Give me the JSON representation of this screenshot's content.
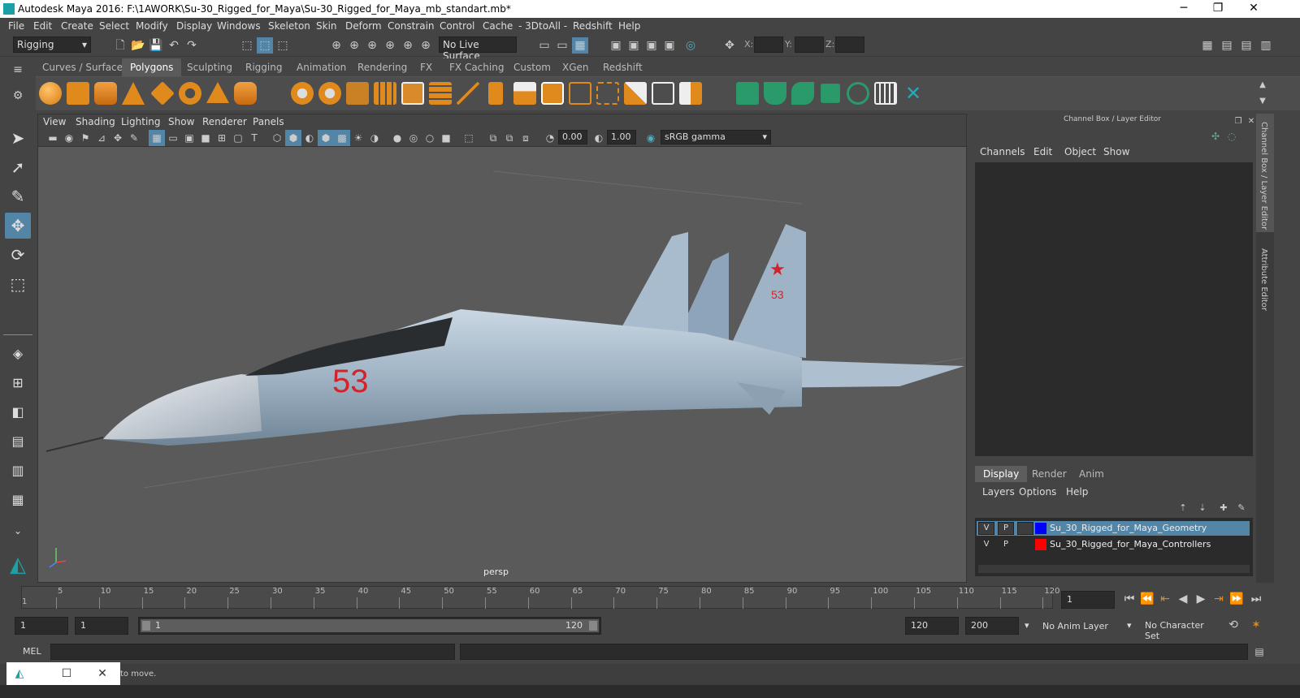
{
  "window": {
    "title": "Autodesk Maya 2016: F:\\1AWORK\\Su-30_Rigged_for_Maya\\Su-30_Rigged_for_Maya_mb_standart.mb*"
  },
  "menubar": [
    "File",
    "Edit",
    "Create",
    "Select",
    "Modify",
    "Display",
    "Windows",
    "Skeleton",
    "Skin",
    "Deform",
    "Constrain",
    "Control",
    "Cache",
    "- 3DtoAll -",
    "Redshift",
    "Help"
  ],
  "status": {
    "mode": "Rigging",
    "live_surface": "No Live Surface",
    "x_label": "X:",
    "y_label": "Y:",
    "z_label": "Z:"
  },
  "shelf_tabs": [
    "Curves / Surfaces",
    "Polygons",
    "Sculpting",
    "Rigging",
    "Animation",
    "Rendering",
    "FX",
    "FX Caching",
    "Custom",
    "XGen",
    "Redshift"
  ],
  "shelf_active": "Polygons",
  "panel": {
    "menu": [
      "View",
      "Shading",
      "Lighting",
      "Show",
      "Renderer",
      "Panels"
    ],
    "exposure": "0.00",
    "gamma": "1.00",
    "colorspace": "sRGB gamma",
    "camera": "persp",
    "nose_number": "53"
  },
  "channel_box": {
    "title": "Channel Box / Layer Editor",
    "menu": [
      "Channels",
      "Edit",
      "Object",
      "Show"
    ],
    "layer_tabs": [
      "Display",
      "Render",
      "Anim"
    ],
    "layer_menu": [
      "Layers",
      "Options",
      "Help"
    ],
    "layers": [
      {
        "v": "V",
        "p": "P",
        "color": "#0000ff",
        "name": "Su_30_Rigged_for_Maya_Geometry",
        "selected": true
      },
      {
        "v": "V",
        "p": "P",
        "color": "#ff0000",
        "name": "Su_30_Rigged_for_Maya_Controllers",
        "selected": false
      }
    ],
    "side_tabs": [
      "Channel Box / Layer Editor",
      "Attribute Editor"
    ]
  },
  "timeline": {
    "ticks": [
      "5",
      "10",
      "15",
      "20",
      "25",
      "30",
      "35",
      "40",
      "45",
      "50",
      "55",
      "60",
      "65",
      "70",
      "75",
      "80",
      "85",
      "90",
      "95",
      "100",
      "105",
      "110",
      "115",
      "120"
    ],
    "start_mark": "1",
    "current_frame": "1"
  },
  "range": {
    "start": "1",
    "playback_start": "1",
    "slider_start": "1",
    "slider_end": "120",
    "playback_end": "120",
    "end": "200",
    "anim_layer": "No Anim Layer",
    "char_set": "No Character Set"
  },
  "cmdline": {
    "label": "MEL"
  },
  "helpline": {
    "text": "to move."
  }
}
